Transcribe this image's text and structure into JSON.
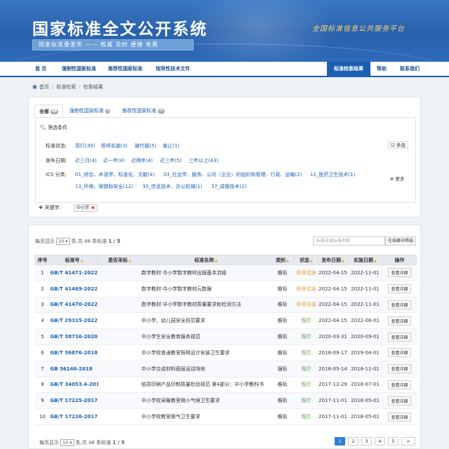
{
  "header": {
    "title": "国家标准全文公开系统",
    "subtitle": "国家标准委发布 —— 权威 及时 便捷 免费",
    "slogan": "全国标准信息公共服务平台"
  },
  "nav": {
    "items": [
      "首 页",
      "强制性国家标准",
      "推荐性国家标准",
      "指导性技术文件"
    ],
    "right": [
      "标准检索结果",
      "帮助",
      "联系我们"
    ]
  },
  "breadcrumb": [
    "首页",
    "标准检索",
    "检索结果"
  ],
  "tabs": [
    {
      "label": "全部",
      "count": "48"
    },
    {
      "label": "强制性国家标准",
      "count": "4"
    },
    {
      "label": "推荐性国家标准",
      "count": "44"
    }
  ],
  "filters": {
    "title": "筛选条件",
    "status_label": "标准状态:",
    "status": [
      "现行(39)",
      "即将实施(3)",
      "被代替(5)",
      "废止(1)"
    ],
    "multi_label": "多选",
    "date_label": "发布日期:",
    "dates": [
      "近三月(4)",
      "近一年(4)",
      "近两年(4)",
      "近三年(5)",
      "三年以上(43)"
    ],
    "ics_label": "ICS 分类:",
    "ics_row1": [
      "01_综合、术语学、标准化、文献(4)",
      "03_社会学、服务、公司（企业）的组织和管理、行政、运输(2)",
      "11_医药卫生技术(1)"
    ],
    "ics_row2": [
      "13_环保、保健和安全(12)",
      "35_信息技术、办公机械(1)",
      "37_成像技术(2)"
    ],
    "more_label": "更多",
    "keyword_label": "关键字:",
    "keyword": "中小学"
  },
  "list": {
    "page_size_prefix": "每页显示",
    "page_size": "10",
    "page_size_suffix": "条,共 48 条标准",
    "page_info": "1 / 5",
    "search_placeholder": "标准号或标准名称",
    "search_button": "在结果中筛选",
    "columns": [
      "序号",
      "标准号",
      "是否采标",
      "标准名称",
      "类别",
      "状态",
      "发布日期",
      "实施日期",
      "操作"
    ],
    "rows": [
      {
        "no": "1",
        "code": "GB/T 41471-2022",
        "adopt": "",
        "name": "数字教材 中小学数字教材出版基本流程",
        "type": "推标",
        "status": "即将实施",
        "pub": "2022-04-15",
        "impl": "2022-11-01",
        "op": "查看详细"
      },
      {
        "no": "2",
        "code": "GB/T 41469-2022",
        "adopt": "",
        "name": "数字教材 中小学数字教材元数据",
        "type": "推标",
        "status": "即将实施",
        "pub": "2022-04-15",
        "impl": "2022-11-01",
        "op": "查看详细"
      },
      {
        "no": "3",
        "code": "GB/T 41470-2022",
        "adopt": "",
        "name": "数字教材 中小学数字教材质量要求和检测方法",
        "type": "推标",
        "status": "即将实施",
        "pub": "2022-04-15",
        "impl": "2022-11-01",
        "op": "查看详细"
      },
      {
        "no": "4",
        "code": "GB/T 29315-2022",
        "adopt": "",
        "name": "中小学、幼儿园安全防范要求",
        "type": "推标",
        "status": "现行",
        "pub": "2022-04-15",
        "impl": "2022-06-01",
        "op": "查看详细"
      },
      {
        "no": "5",
        "code": "GB/T 38716-2020",
        "adopt": "",
        "name": "中小学生安全教育服务规范",
        "type": "推标",
        "status": "现行",
        "pub": "2020-03-31",
        "impl": "2020-09-01",
        "op": "查看详细"
      },
      {
        "no": "6",
        "code": "GB/T 36876-2018",
        "adopt": "",
        "name": "中小学校普通教室照明设计安装卫生要求",
        "type": "推标",
        "status": "现行",
        "pub": "2018-09-17",
        "impl": "2019-04-01",
        "op": "查看详细"
      },
      {
        "no": "7",
        "code": "GB 36246-2018",
        "adopt": "",
        "name": "中小学合成材料面层运动场地",
        "type": "强标",
        "status": "现行",
        "pub": "2018-05-14",
        "impl": "2018-11-01",
        "op": "查看详细"
      },
      {
        "no": "8",
        "code": "GB/T 34053.4-2017",
        "adopt": "",
        "name": "纸质印刷产品印制质量检验规范 第4部分：中小学教科书",
        "type": "推标",
        "status": "现行",
        "pub": "2017-12-29",
        "impl": "2018-07-01",
        "op": "查看详细"
      },
      {
        "no": "9",
        "code": "GB/T 17225-2017",
        "adopt": "",
        "name": "中小学校采暖教室微小气候卫生要求",
        "type": "推标",
        "status": "现行",
        "pub": "2017-11-01",
        "impl": "2018-05-01",
        "op": "查看详细"
      },
      {
        "no": "10",
        "code": "GB/T 17226-2017",
        "adopt": "",
        "name": "中小学校教室换气卫生要求",
        "type": "推标",
        "status": "现行",
        "pub": "2017-11-01",
        "impl": "2018-05-01",
        "op": "查看详细"
      }
    ],
    "pages": [
      "1",
      "2",
      "3",
      "4",
      "5",
      ">"
    ],
    "bottom_page_size_prefix": "每页显示",
    "bottom_page_size": "10",
    "bottom_page_size_suffix": "条,共 48 条标准",
    "bottom_page_info": "1 / 5"
  },
  "colors": {
    "primary": "#1a5fb4",
    "upcoming": "#e6a23c",
    "current": "#4a9c3a"
  }
}
